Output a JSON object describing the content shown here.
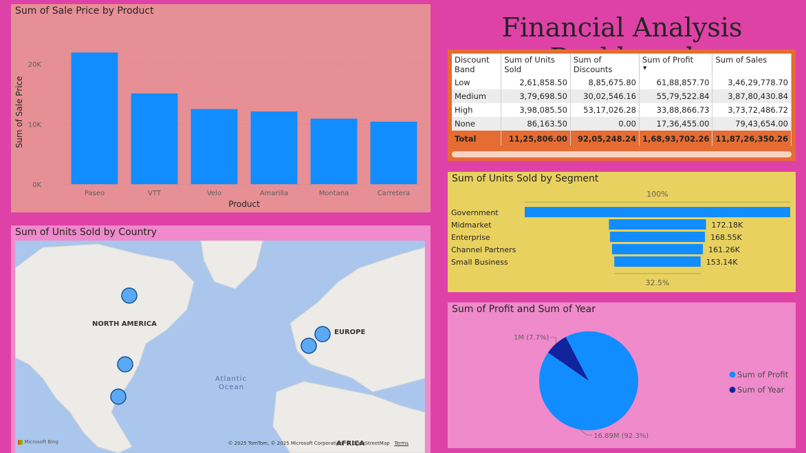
{
  "dashboard_title": "Financial Analysis Dashboard",
  "bar_panel": {
    "title": "Sum of Sale Price by Product"
  },
  "map_panel": {
    "title": "Sum of Units Sold by Country",
    "labels": {
      "north_america": "NORTH AMERICA",
      "europe": "EUROPE",
      "atlantic": "Atlantic",
      "ocean": "Ocean",
      "africa": "AFRICA"
    },
    "bing": "Microsoft Bing",
    "copyright": "© 2025 TomTom, © 2025 Microsoft Corporation, © OpenStreetMap",
    "terms": "Terms"
  },
  "matrix": {
    "headers": [
      "Discount Band",
      "Sum of Units Sold",
      "Sum of Discounts",
      "Sum of Profit",
      "Sum of Sales"
    ],
    "rows": [
      [
        "Low",
        "2,61,858.50",
        "8,85,675.80",
        "61,88,857.70",
        "3,46,29,778.70"
      ],
      [
        "Medium",
        "3,79,698.50",
        "30,02,546.16",
        "55,79,522.84",
        "3,87,80,430.84"
      ],
      [
        "High",
        "3,98,085.50",
        "53,17,026.28",
        "33,88,866.73",
        "3,73,72,486.72"
      ],
      [
        "None",
        "86,163.50",
        "0.00",
        "17,36,455.00",
        "79,43,654.00"
      ]
    ],
    "total": [
      "Total",
      "11,25,806.00",
      "92,05,248.24",
      "1,68,93,702.26",
      "11,87,26,350.26"
    ]
  },
  "funnel_panel": {
    "title": "Sum of Units Sold by Segment",
    "top_label": "100%",
    "bottom_label": "32.5%"
  },
  "pie_panel": {
    "title": "Sum of Profit and Sum of Year"
  },
  "chart_data": [
    {
      "type": "bar",
      "title": "Sum of Sale Price by Product",
      "xlabel": "Product",
      "ylabel": "Sum of Sale Price",
      "categories": [
        "Paseo",
        "VTT",
        "Velo",
        "Amarilla",
        "Montana",
        "Carretera"
      ],
      "values": [
        21900,
        15100,
        12500,
        12100,
        10900,
        10400
      ],
      "ylim": [
        0,
        24000
      ],
      "yticks": [
        0,
        10000,
        20000
      ],
      "ytick_labels": [
        "0K",
        "10K",
        "20K"
      ],
      "color": "#118dff"
    },
    {
      "type": "funnel",
      "title": "Sum of Units Sold by Segment",
      "categories": [
        "Government",
        "Midmarket",
        "Enterprise",
        "Channel Partners",
        "Small Business"
      ],
      "values": [
        471000,
        172180,
        168550,
        161260,
        153140
      ],
      "value_labels": [
        "",
        "172.18K",
        "168.55K",
        "161.26K",
        "153.14K"
      ],
      "color": "#118dff"
    },
    {
      "type": "pie",
      "title": "Sum of Profit and Sum of Year",
      "series": [
        {
          "name": "Sum of Profit",
          "value": 16890000,
          "label": "16.89M (92.3%)",
          "color": "#118dff"
        },
        {
          "name": "Sum of Year",
          "value": 1400000,
          "label": "1M (7.7%)",
          "color": "#12239e"
        }
      ],
      "legend": "right"
    }
  ]
}
